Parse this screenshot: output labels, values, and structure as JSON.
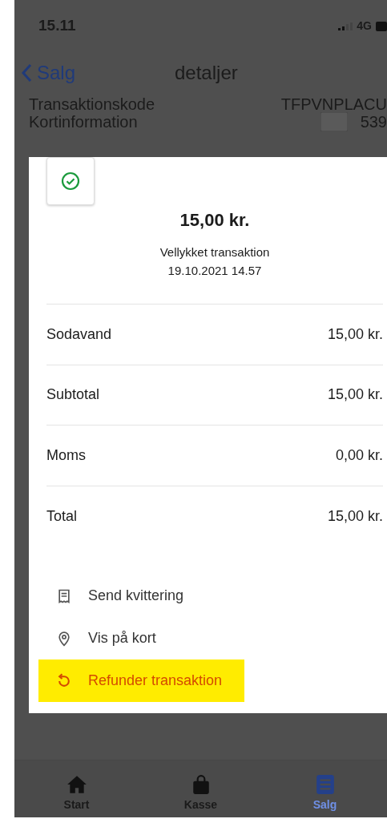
{
  "status_bar": {
    "time": "15.11",
    "network": "4G"
  },
  "nav": {
    "back_label": "Salg",
    "title": "detaljer"
  },
  "details": [
    {
      "label": "Transaktionskode",
      "value": "TFPVNPLACU"
    },
    {
      "label": "Kortinformation",
      "value": "539"
    }
  ],
  "sheet": {
    "amount": "15,00 kr.",
    "status": "Vellykket transaktion",
    "date": "19.10.2021 14.57",
    "lines": [
      {
        "label": "Sodavand",
        "value": "15,00 kr."
      },
      {
        "label": "Subtotal",
        "value": "15,00 kr."
      },
      {
        "label": "Moms",
        "value": "0,00 kr."
      },
      {
        "label": "Total",
        "value": "15,00 kr."
      }
    ],
    "actions": [
      {
        "kind": "receipt",
        "label": "Send kvittering",
        "highlighted": false
      },
      {
        "kind": "pin",
        "label": "Vis på kort",
        "highlighted": false
      },
      {
        "kind": "refund",
        "label": "Refunder transaktion",
        "highlighted": true
      }
    ]
  },
  "tabs": [
    {
      "kind": "home",
      "label": "Start",
      "selected": false
    },
    {
      "kind": "bag",
      "label": "Kasse",
      "selected": false
    },
    {
      "kind": "list",
      "label": "Salg",
      "selected": true
    }
  ]
}
